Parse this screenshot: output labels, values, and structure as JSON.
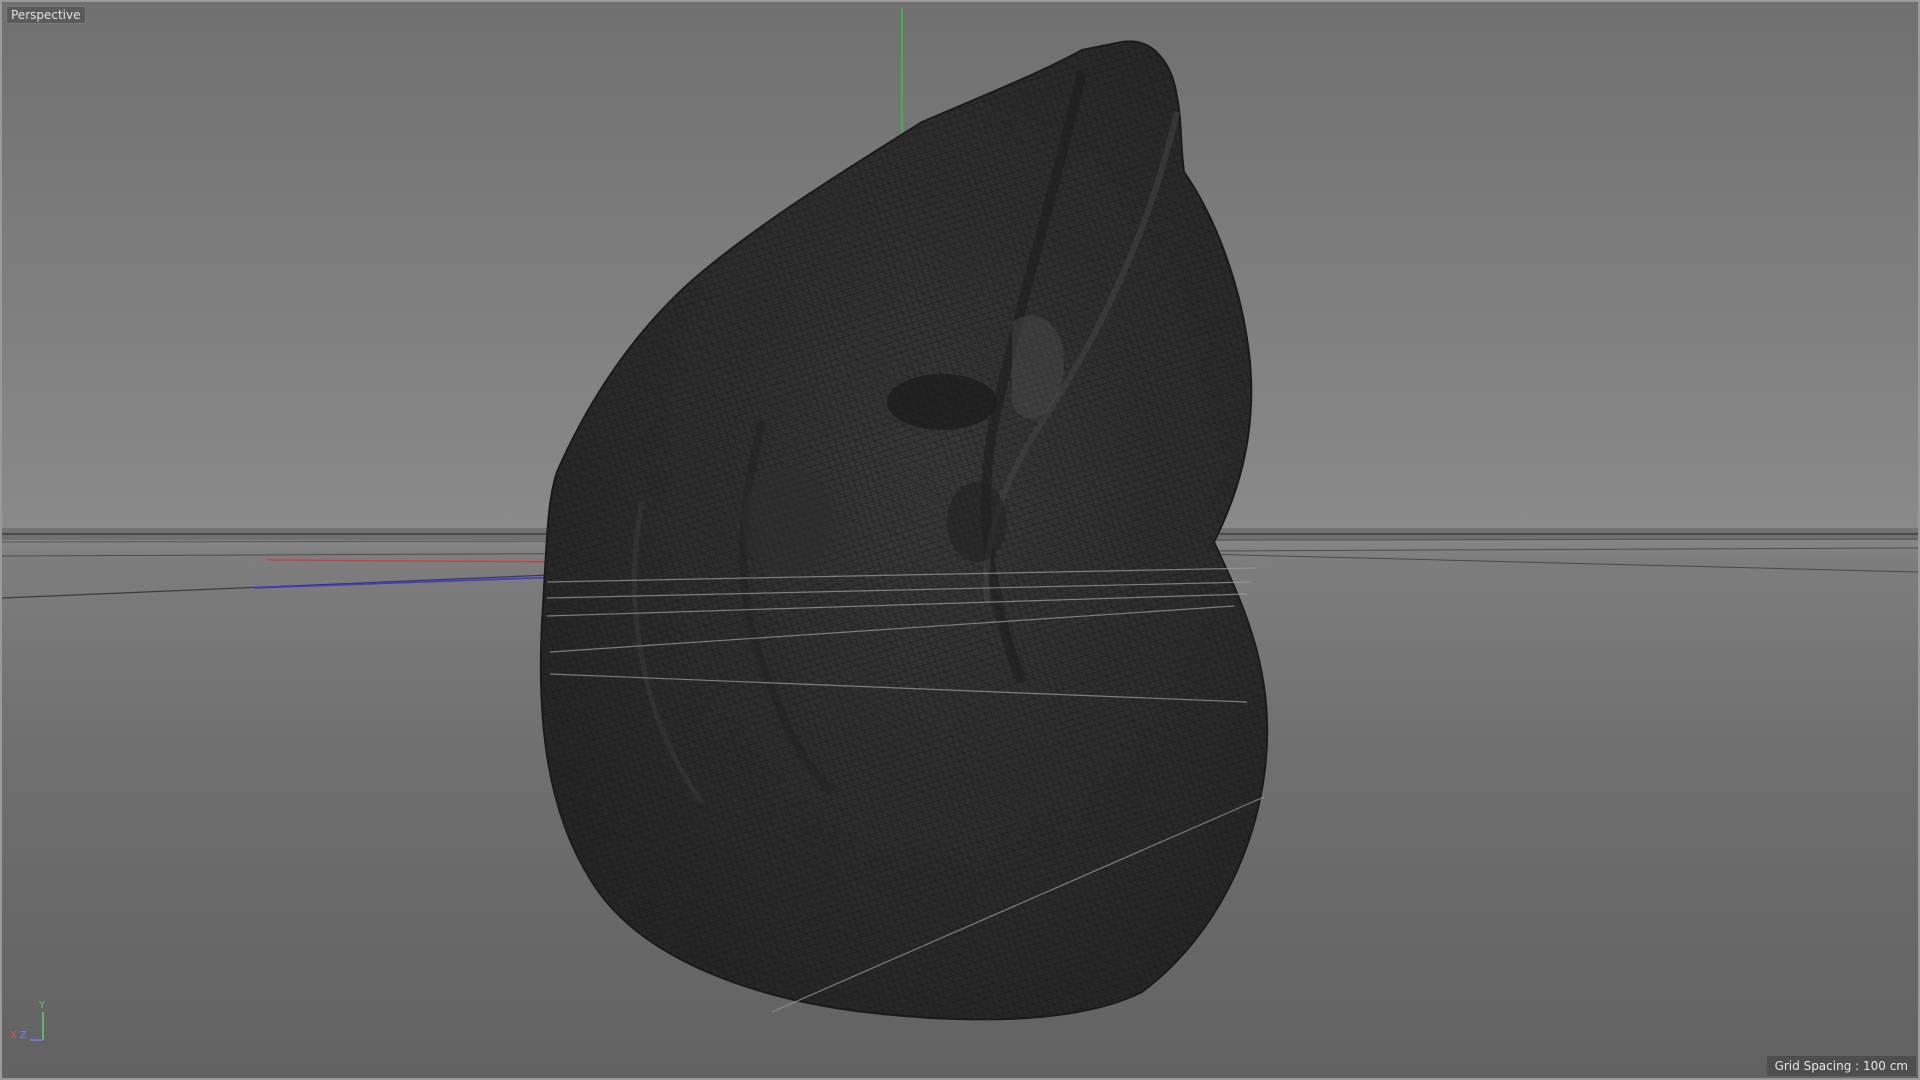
{
  "viewport": {
    "label": "Perspective",
    "grid_spacing_text": "Grid Spacing : 100 cm"
  },
  "axis_gizmo": {
    "y": "Y",
    "x": "X",
    "z": "Z"
  },
  "colors": {
    "x_axis": "#d23a3a",
    "y_axis": "#2fd02f",
    "z_axis": "#3b3bdc",
    "mesh": "#2a2a2a",
    "wire": "#141414",
    "background_top": "#707070",
    "background_bottom": "#626262"
  },
  "icons": [
    "axis-gizmo-icon"
  ]
}
